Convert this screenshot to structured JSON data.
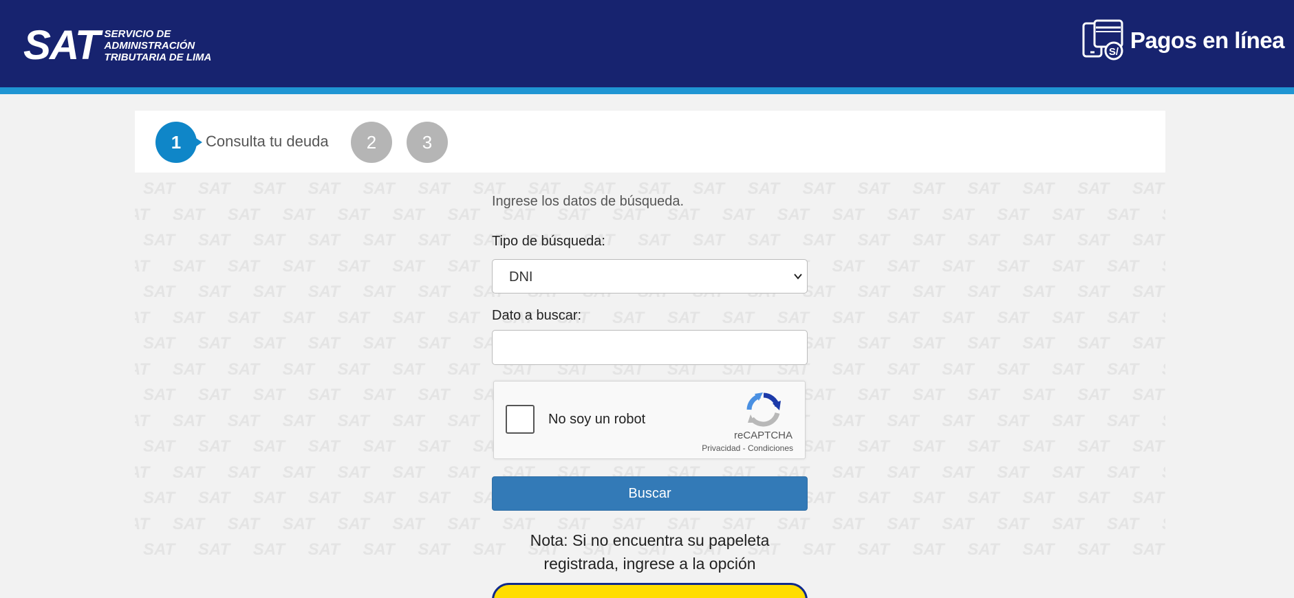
{
  "header": {
    "logo_main": "SAT",
    "logo_sub_lines": [
      "SERVICIO DE",
      "ADMINISTRACIÓN",
      "TRIBUTARIA DE LIMA"
    ],
    "pagos_label": "Pagos en línea",
    "bg_color": "#17236f",
    "stripe_color": "#1f95d3"
  },
  "steps": {
    "step1_number": "1",
    "step1_label": "Consulta tu deuda",
    "step2_number": "2",
    "step3_number": "3",
    "active_color": "#0f86c8",
    "inactive_color": "#b5b5b5"
  },
  "watermark": {
    "text": "SAT"
  },
  "form": {
    "intro": "Ingrese los datos de búsqueda.",
    "tipo_label": "Tipo de búsqueda:",
    "tipo_value": "DNI",
    "dato_label": "Dato a buscar:",
    "dato_value": "",
    "captcha_label": "No soy un robot",
    "captcha_brand": "reCAPTCHA",
    "captcha_links": "Privacidad - Condiciones",
    "buscar_label": "Buscar",
    "nota": "Nota: Si no encuentra su papeleta registrada, ingrese a la opción",
    "button_color": "#337ab7"
  }
}
